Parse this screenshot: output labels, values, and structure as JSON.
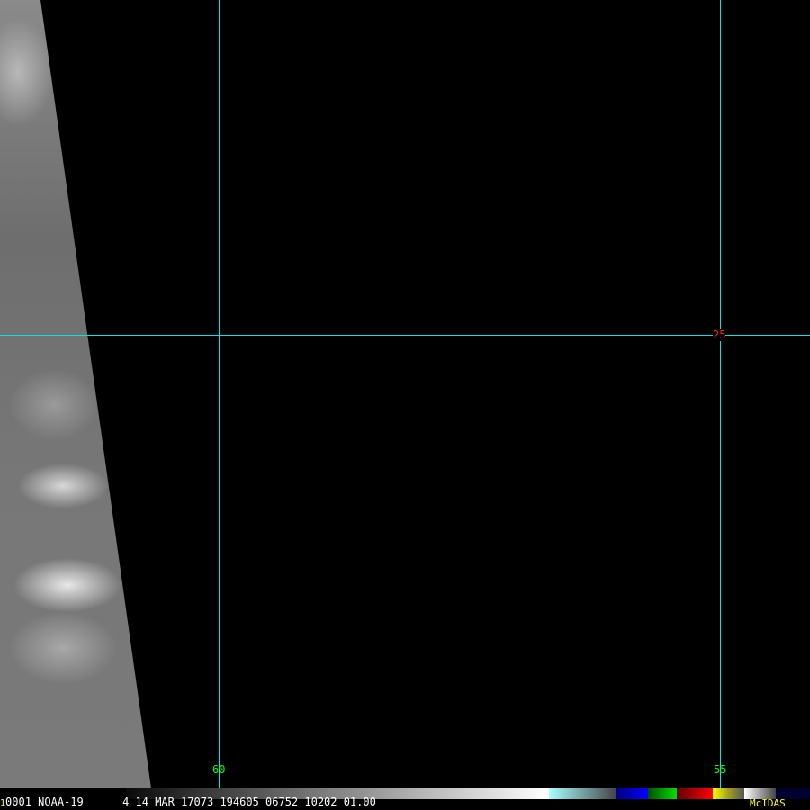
{
  "image": {
    "satellite_label": "NOAA-19"
  },
  "grid": {
    "lon_labels": [
      "60",
      "55"
    ],
    "lat_labels": [
      "25"
    ]
  },
  "colors": {
    "grid": "#00e5e5",
    "lon_label": "#00ff00",
    "lat_label": "#ff0000",
    "brand": "#ffff00"
  },
  "status": {
    "frame": "1",
    "text": "0001 NOAA-19      4 14 MAR 17073 194605 06752 10202 01.00",
    "brand": "McIDAS"
  }
}
